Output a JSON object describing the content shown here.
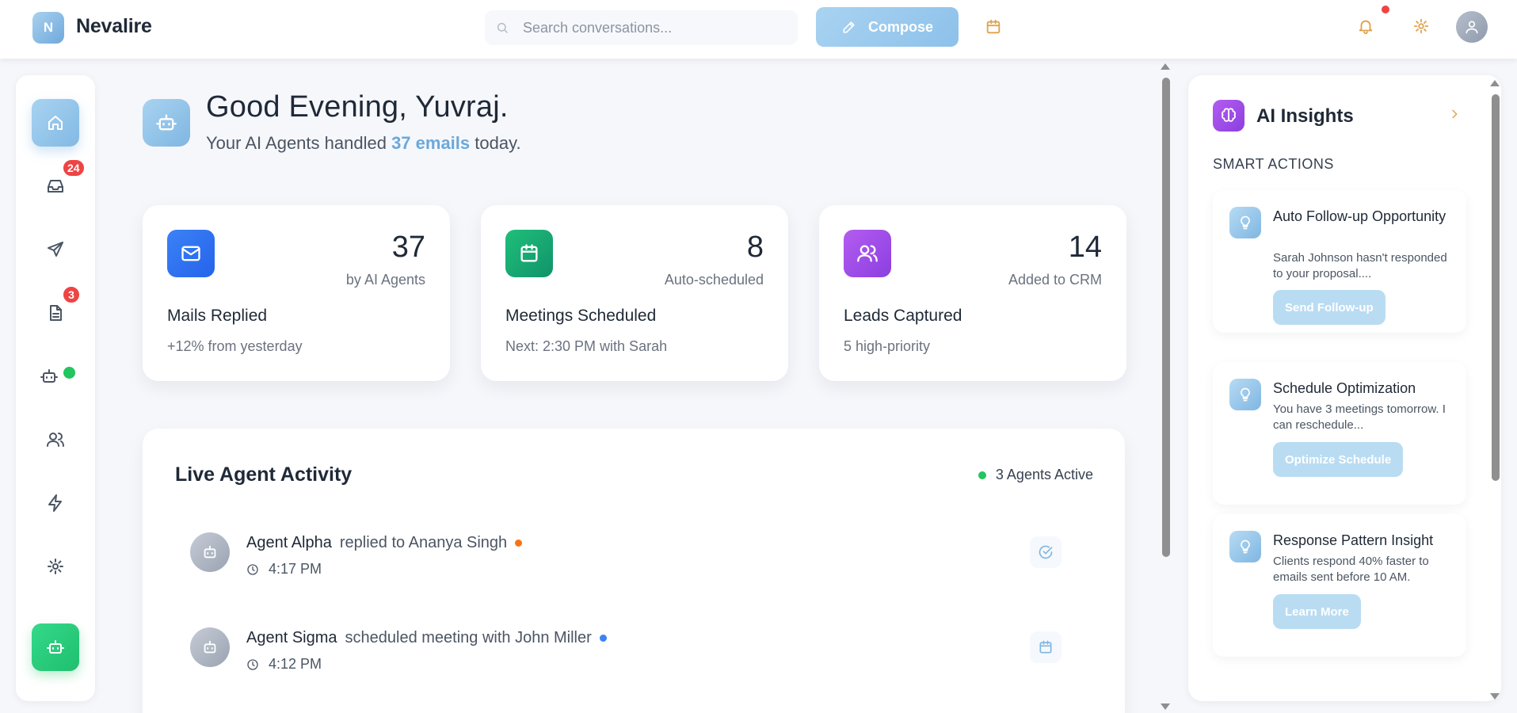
{
  "app": {
    "logo_letter": "N",
    "name": "Nevalire"
  },
  "topbar": {
    "search_placeholder": "Search conversations...",
    "compose_label": "Compose",
    "notification_indicator": true
  },
  "sidebar": {
    "items": [
      {
        "name": "home",
        "active": true
      },
      {
        "name": "inbox",
        "badge": "24"
      },
      {
        "name": "sent"
      },
      {
        "name": "documents",
        "badge": "3"
      },
      {
        "name": "agents",
        "online": true
      },
      {
        "name": "contacts"
      },
      {
        "name": "automations"
      },
      {
        "name": "settings"
      },
      {
        "name": "ai-agent"
      }
    ]
  },
  "greeting": {
    "title": "Good Evening, Yuvraj.",
    "sub_prefix": "Your AI Agents handled ",
    "sub_highlight": "37 emails",
    "sub_suffix": " today."
  },
  "stats": [
    {
      "icon": "mail-icon",
      "value": "37",
      "caption": "by AI Agents",
      "title": "Mails Replied",
      "sub": "+12% from yesterday",
      "color": "#2f6fe6"
    },
    {
      "icon": "calendar-icon",
      "value": "8",
      "caption": "Auto-scheduled",
      "title": "Meetings Scheduled",
      "sub": "Next: 2:30 PM with Sarah",
      "color": "#16a06a"
    },
    {
      "icon": "users-icon",
      "value": "14",
      "caption": "Added to CRM",
      "title": "Leads Captured",
      "sub": "5 high-priority",
      "color": "#9a4ae6"
    }
  ],
  "activity": {
    "title": "Live Agent Activity",
    "status": "3 Agents Active",
    "rows": [
      {
        "agent": "Agent Alpha",
        "action": "replied to Ananya Singh",
        "time": "4:17 PM",
        "dot_color": "#f97316",
        "icon": "check-circle-icon"
      },
      {
        "agent": "Agent Sigma",
        "action": "scheduled meeting with John Miller",
        "time": "4:12 PM",
        "dot_color": "#3b82f6",
        "icon": "calendar-icon"
      }
    ]
  },
  "insights": {
    "title": "AI Insights",
    "section": "SMART ACTIONS",
    "cards": [
      {
        "title": "Auto Follow-up Opportunity",
        "text": "Sarah Johnson hasn't responded to your proposal....",
        "button": "Send Follow-up"
      },
      {
        "title": "Schedule Optimization",
        "text": "You have 3 meetings tomorrow. I can reschedule...",
        "button": "Optimize Schedule"
      },
      {
        "title": "Response Pattern Insight",
        "text": "Clients respond 40% faster to emails sent before 10 AM.",
        "button": "Learn More"
      }
    ]
  },
  "colors": {
    "accent": "#8dc1ea",
    "success": "#22c55e",
    "badge": "#ef4444",
    "icon_orange": "#e0a24a"
  }
}
